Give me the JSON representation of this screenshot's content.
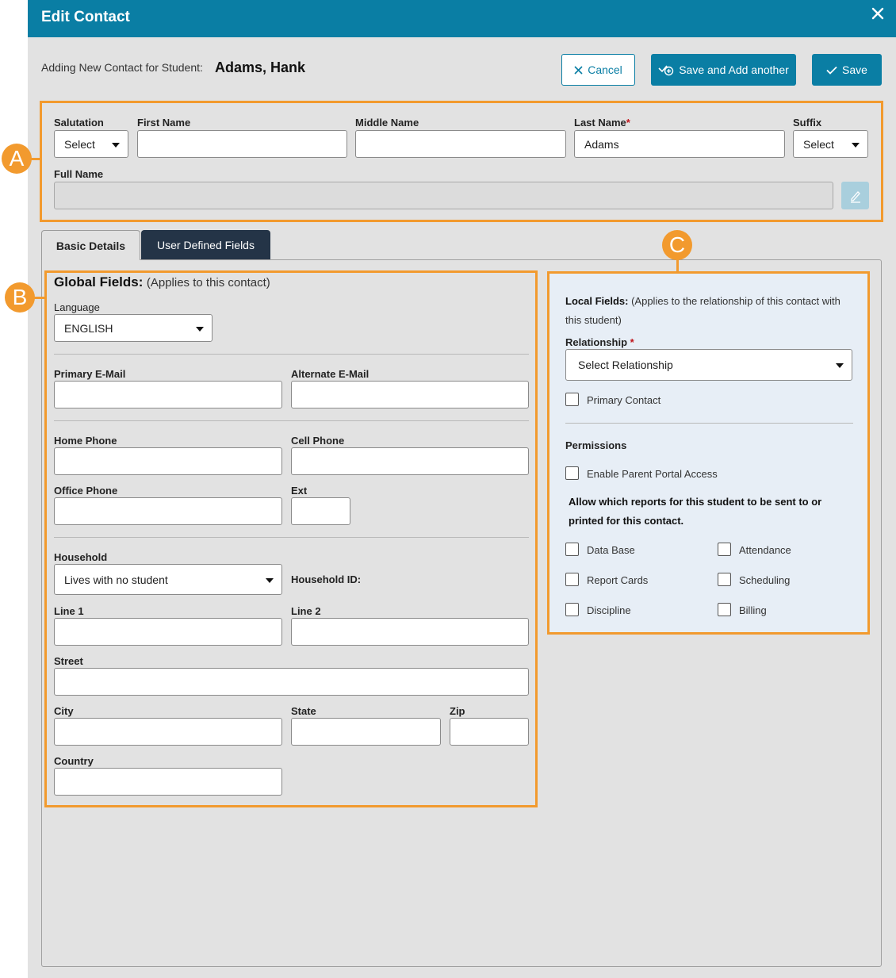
{
  "dialog": {
    "title": "Edit Contact",
    "close_icon": "close-icon"
  },
  "header": {
    "adding_label": "Adding New Contact for Student:",
    "student_name": "Adams, Hank",
    "cancel_label": "Cancel",
    "save_add_label": "Save and Add another",
    "save_label": "Save"
  },
  "name_section": {
    "salutation_label": "Salutation",
    "salutation_value": "Select",
    "first_name_label": "First Name",
    "first_name_value": "",
    "middle_name_label": "Middle Name",
    "middle_name_value": "",
    "last_name_label": "Last Name",
    "last_name_required": "*",
    "last_name_value": "Adams",
    "suffix_label": "Suffix",
    "suffix_value": "Select",
    "full_name_label": "Full Name",
    "full_name_value": ""
  },
  "callouts": {
    "a": "A",
    "b": "B",
    "c": "C"
  },
  "tabs": [
    {
      "label": "Basic Details",
      "active": true
    },
    {
      "label": "User Defined Fields",
      "active": false
    }
  ],
  "global": {
    "heading": "Global Fields:",
    "subheading": "(Applies to this contact)",
    "language_label": "Language",
    "language_value": "ENGLISH",
    "primary_email_label": "Primary E-Mail",
    "alternate_email_label": "Alternate E-Mail",
    "home_phone_label": "Home Phone",
    "cell_phone_label": "Cell Phone",
    "office_phone_label": "Office Phone",
    "ext_label": "Ext",
    "household_label": "Household",
    "household_value": "Lives with no student",
    "household_id_label": "Household ID:",
    "line1_label": "Line 1",
    "line2_label": "Line 2",
    "street_label": "Street",
    "city_label": "City",
    "state_label": "State",
    "zip_label": "Zip",
    "country_label": "Country"
  },
  "local": {
    "heading": "Local Fields:",
    "subheading_1": "(Applies to the relationship of this contact with",
    "subheading_2": "this student)",
    "relationship_label": "Relationship",
    "relationship_required": "*",
    "relationship_value": "Select Relationship",
    "primary_contact_label": "Primary Contact",
    "permissions_label": "Permissions",
    "parent_portal_label": "Enable Parent Portal Access",
    "reports_text_1": "Allow which reports for this student to be sent to or",
    "reports_text_2": "printed for this contact.",
    "reports": [
      "Data Base",
      "Attendance",
      "Report Cards",
      "Scheduling",
      "Discipline",
      "Billing"
    ]
  },
  "colors": {
    "primary": "#0a7ea4",
    "tab_dark": "#243447",
    "callout": "#f29a2e",
    "local_bg": "#e7eef6"
  }
}
